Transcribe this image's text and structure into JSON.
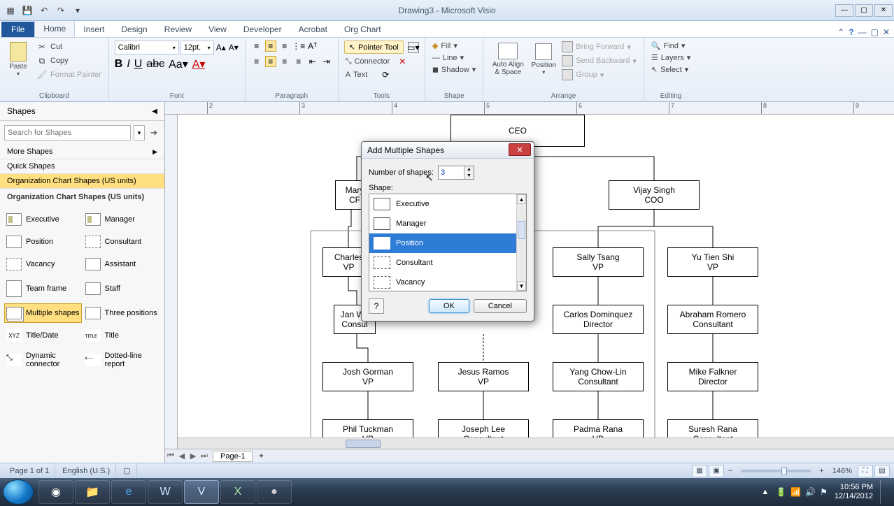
{
  "window": {
    "title": "Drawing3 - Microsoft Visio"
  },
  "ribbon": {
    "file": "File",
    "tabs": [
      "Home",
      "Insert",
      "Design",
      "Review",
      "View",
      "Developer",
      "Acrobat",
      "Org Chart"
    ],
    "active_tab": "Home",
    "clipboard": {
      "paste": "Paste",
      "cut": "Cut",
      "copy": "Copy",
      "format_painter": "Format Painter",
      "label": "Clipboard"
    },
    "font": {
      "name": "Calibri",
      "size": "12pt.",
      "label": "Font"
    },
    "paragraph": {
      "label": "Paragraph"
    },
    "tools": {
      "pointer": "Pointer Tool",
      "connector": "Connector",
      "text": "Text",
      "label": "Tools"
    },
    "shape": {
      "fill": "Fill",
      "line": "Line",
      "shadow": "Shadow",
      "label": "Shape"
    },
    "arrange": {
      "autoalign": "Auto Align & Space",
      "position": "Position",
      "bring_forward": "Bring Forward",
      "send_backward": "Send Backward",
      "group": "Group",
      "label": "Arrange"
    },
    "editing": {
      "find": "Find",
      "layers": "Layers",
      "select": "Select",
      "label": "Editing"
    }
  },
  "shapes_pane": {
    "title": "Shapes",
    "search_placeholder": "Search for Shapes",
    "more_shapes": "More Shapes",
    "quick_shapes": "Quick Shapes",
    "stencil_tab": "Organization Chart Shapes (US units)",
    "stencil_title": "Organization Chart Shapes (US units)",
    "items": [
      {
        "label": "Executive"
      },
      {
        "label": "Manager"
      },
      {
        "label": "Position"
      },
      {
        "label": "Consultant"
      },
      {
        "label": "Vacancy"
      },
      {
        "label": "Assistant"
      },
      {
        "label": "Team frame"
      },
      {
        "label": "Staff"
      },
      {
        "label": "Multiple shapes"
      },
      {
        "label": "Three positions"
      },
      {
        "label": "Title/Date"
      },
      {
        "label": "Title"
      },
      {
        "label": "Dynamic connector"
      },
      {
        "label": "Dotted-line report"
      }
    ]
  },
  "canvas": {
    "page_tab": "Page-1",
    "boxes": {
      "ceo": {
        "name": "",
        "title": "CEO"
      },
      "mary": {
        "name": "Mary",
        "title": "CF"
      },
      "vijay": {
        "name": "Vijay Singh",
        "title": "COO"
      },
      "charles": {
        "name": "Charles",
        "title": "VP"
      },
      "sally": {
        "name": "Sally Tsang",
        "title": "VP"
      },
      "yutien": {
        "name": "Yu Tien Shi",
        "title": "VP"
      },
      "janw": {
        "name": "Jan We",
        "title": "Consul"
      },
      "carlos": {
        "name": "Carlos Dominquez",
        "title": "Director"
      },
      "abraham": {
        "name": "Abraham Romero",
        "title": "Consultant"
      },
      "josh": {
        "name": "Josh Gorman",
        "title": "VP"
      },
      "jesus": {
        "name": "Jesus Ramos",
        "title": "VP"
      },
      "yang": {
        "name": "Yang Chow-Lin",
        "title": "Consultant"
      },
      "mike": {
        "name": "Mike Falkner",
        "title": "Director"
      },
      "phil": {
        "name": "Phil Tuckman",
        "title": "VP"
      },
      "joseph": {
        "name": "Joseph Lee",
        "title": "Consultant"
      },
      "padma": {
        "name": "Padma Rana",
        "title": "VP"
      },
      "suresh": {
        "name": "Suresh Rana",
        "title": "Consultant"
      }
    }
  },
  "dialog": {
    "title": "Add Multiple Shapes",
    "number_label": "Number of shapes:",
    "number_value": "3",
    "shape_label": "Shape:",
    "options": [
      "Executive",
      "Manager",
      "Position",
      "Consultant",
      "Vacancy"
    ],
    "selected": "Position",
    "ok": "OK",
    "cancel": "Cancel"
  },
  "status": {
    "page": "Page 1 of 1",
    "lang": "English (U.S.)",
    "zoom": "146%"
  },
  "taskbar": {
    "time": "10:56 PM",
    "date": "12/14/2012"
  }
}
